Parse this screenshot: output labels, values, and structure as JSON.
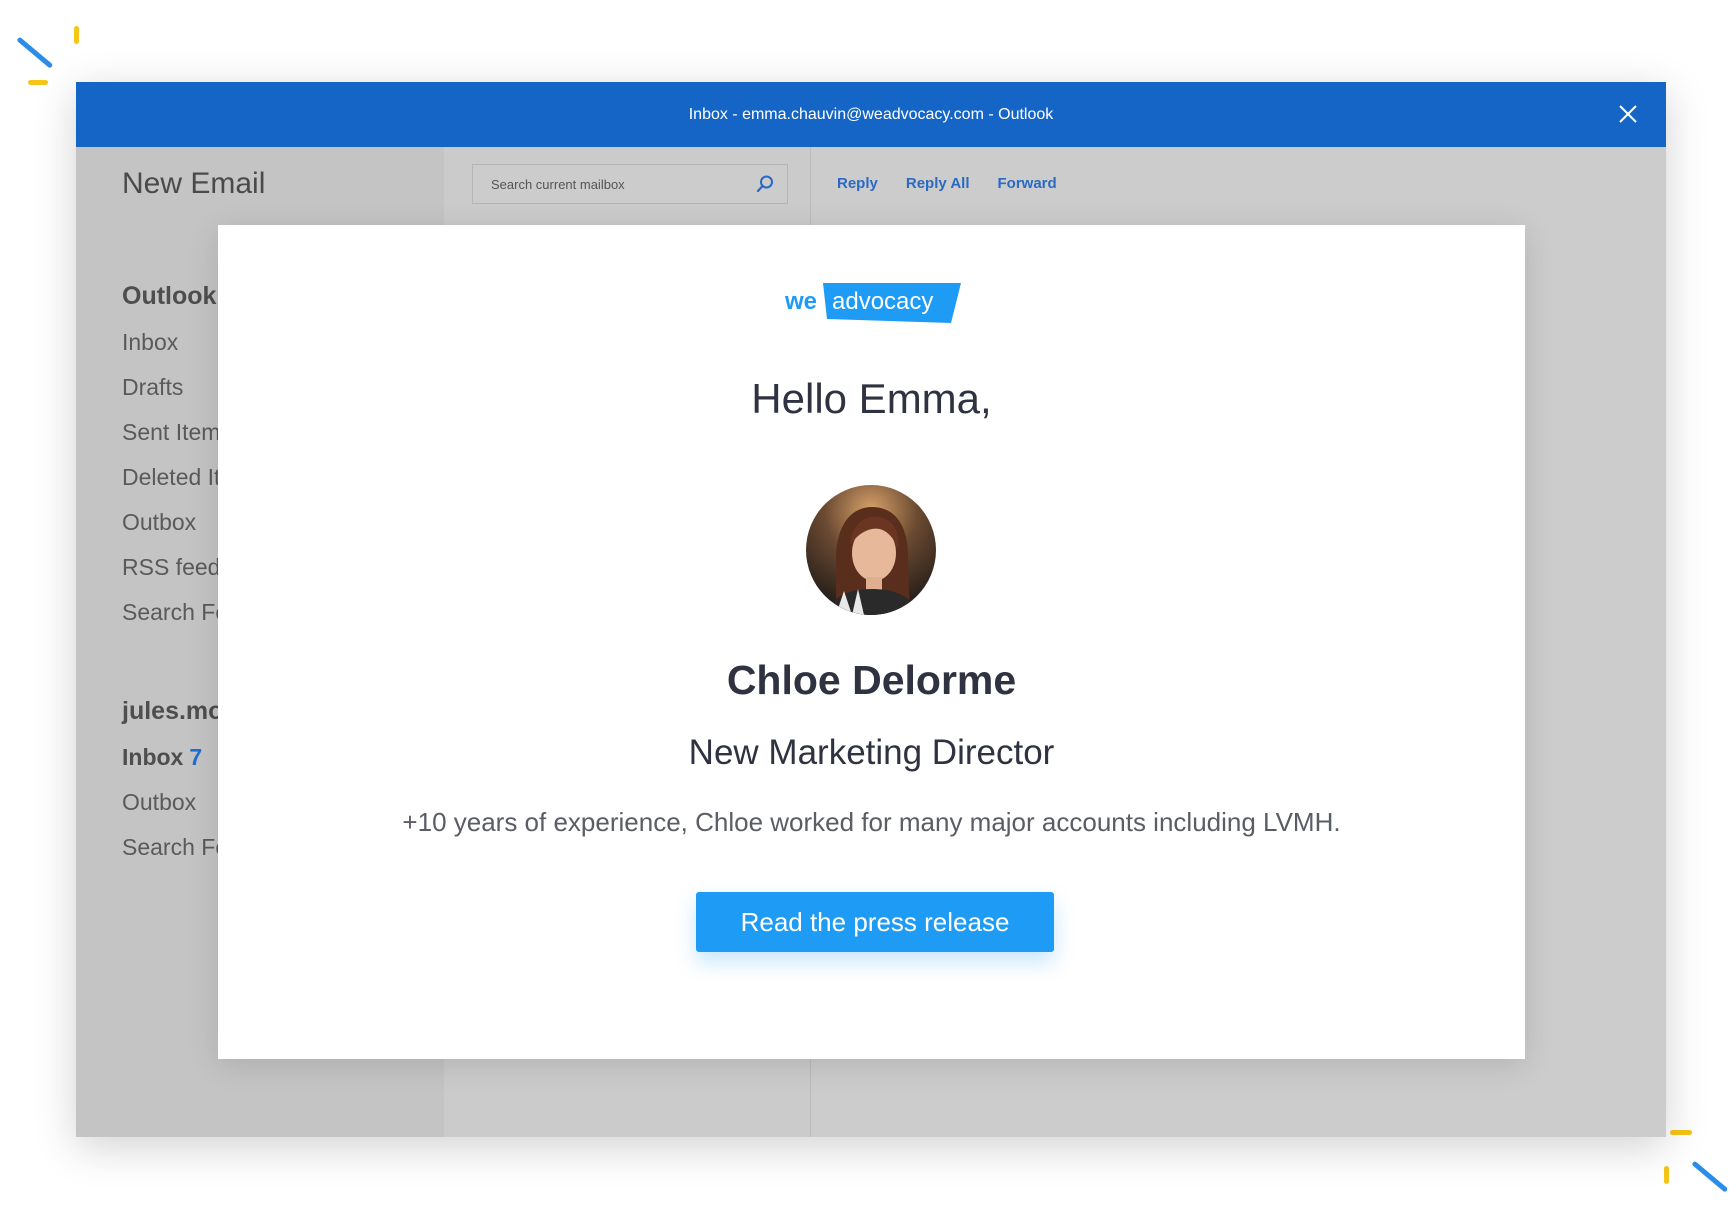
{
  "window": {
    "title": "Inbox - emma.chauvin@weadvocacy.com - Outlook",
    "accent_color": "#1565c6"
  },
  "nav": {
    "new_email": "New Email",
    "sections": [
      {
        "title": "Outlook",
        "items": [
          "Inbox",
          "Drafts",
          "Sent Items",
          "Deleted Items",
          "Outbox",
          "RSS feeds",
          "Search Folders"
        ]
      },
      {
        "title": "jules.mo",
        "items": [
          {
            "label": "Inbox",
            "count": "7"
          },
          {
            "label": "Outbox"
          },
          {
            "label": "Search Folders"
          }
        ]
      }
    ]
  },
  "search": {
    "placeholder": "Search current mailbox",
    "icon": "search-icon"
  },
  "toolbar": {
    "reply": "Reply",
    "reply_all": "Reply All",
    "forward": "Forward"
  },
  "email": {
    "logo": {
      "we": "we",
      "advocacy": "advocacy",
      "color": "#1e9bf5"
    },
    "greeting": "Hello Emma,",
    "name": "Chloe Delorme",
    "role": "New Marketing Director",
    "bio": "+10 years of experience, Chloe worked for many major accounts including LVMH.",
    "cta": "Read the press release",
    "cta_color": "#1e9bf5"
  }
}
